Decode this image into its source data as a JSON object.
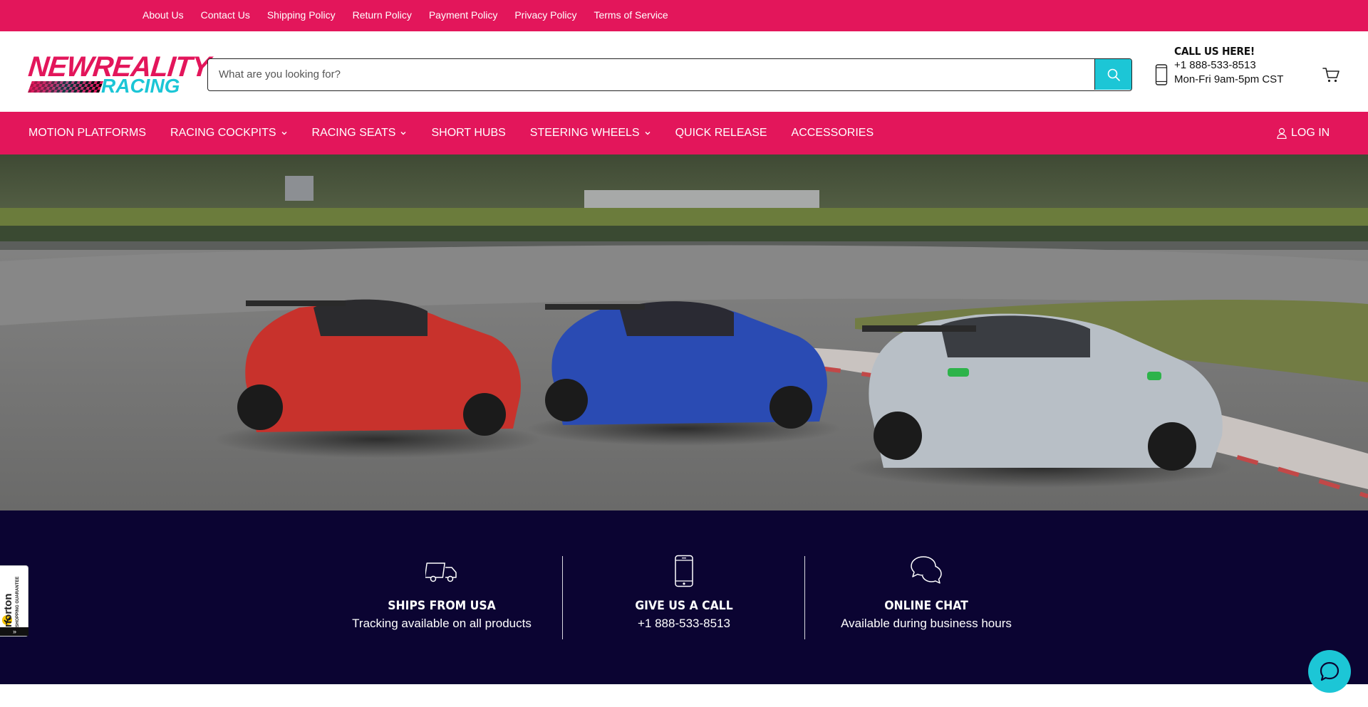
{
  "topbar": {
    "links": [
      "About Us",
      "Contact Us",
      "Shipping Policy",
      "Return Policy",
      "Payment Policy",
      "Privacy Policy",
      "Terms of Service"
    ]
  },
  "header": {
    "logo_top": "NEWREALITY",
    "logo_bottom": "RACING",
    "search_placeholder": "What are you looking for?",
    "call_title": "CALL US HERE!",
    "call_phone": "+1 888-533-8513",
    "call_hours": "Mon-Fri 9am-5pm CST"
  },
  "nav": {
    "items": [
      "MOTION PLATFORMS",
      "RACING COCKPITS",
      "RACING SEATS",
      "SHORT HUBS",
      "STEERING WHEELS",
      "QUICK RELEASE",
      "ACCESSORIES"
    ],
    "login": "LOG IN"
  },
  "features": [
    {
      "title": "SHIPS FROM USA",
      "subtitle": "Tracking available on all products",
      "icon": "truck-icon"
    },
    {
      "title": "GIVE US A CALL",
      "subtitle": "+1 888-533-8513",
      "icon": "phone-icon"
    },
    {
      "title": "ONLINE CHAT",
      "subtitle": "Available during business hours",
      "icon": "chat-bubbles-icon"
    }
  ],
  "norton": {
    "label": "norton",
    "sub": "SHOPPING GUARANTEE"
  },
  "colors": {
    "brand_pink": "#e3165b",
    "brand_cyan": "#1cc6d6",
    "navy": "#0b0432"
  }
}
